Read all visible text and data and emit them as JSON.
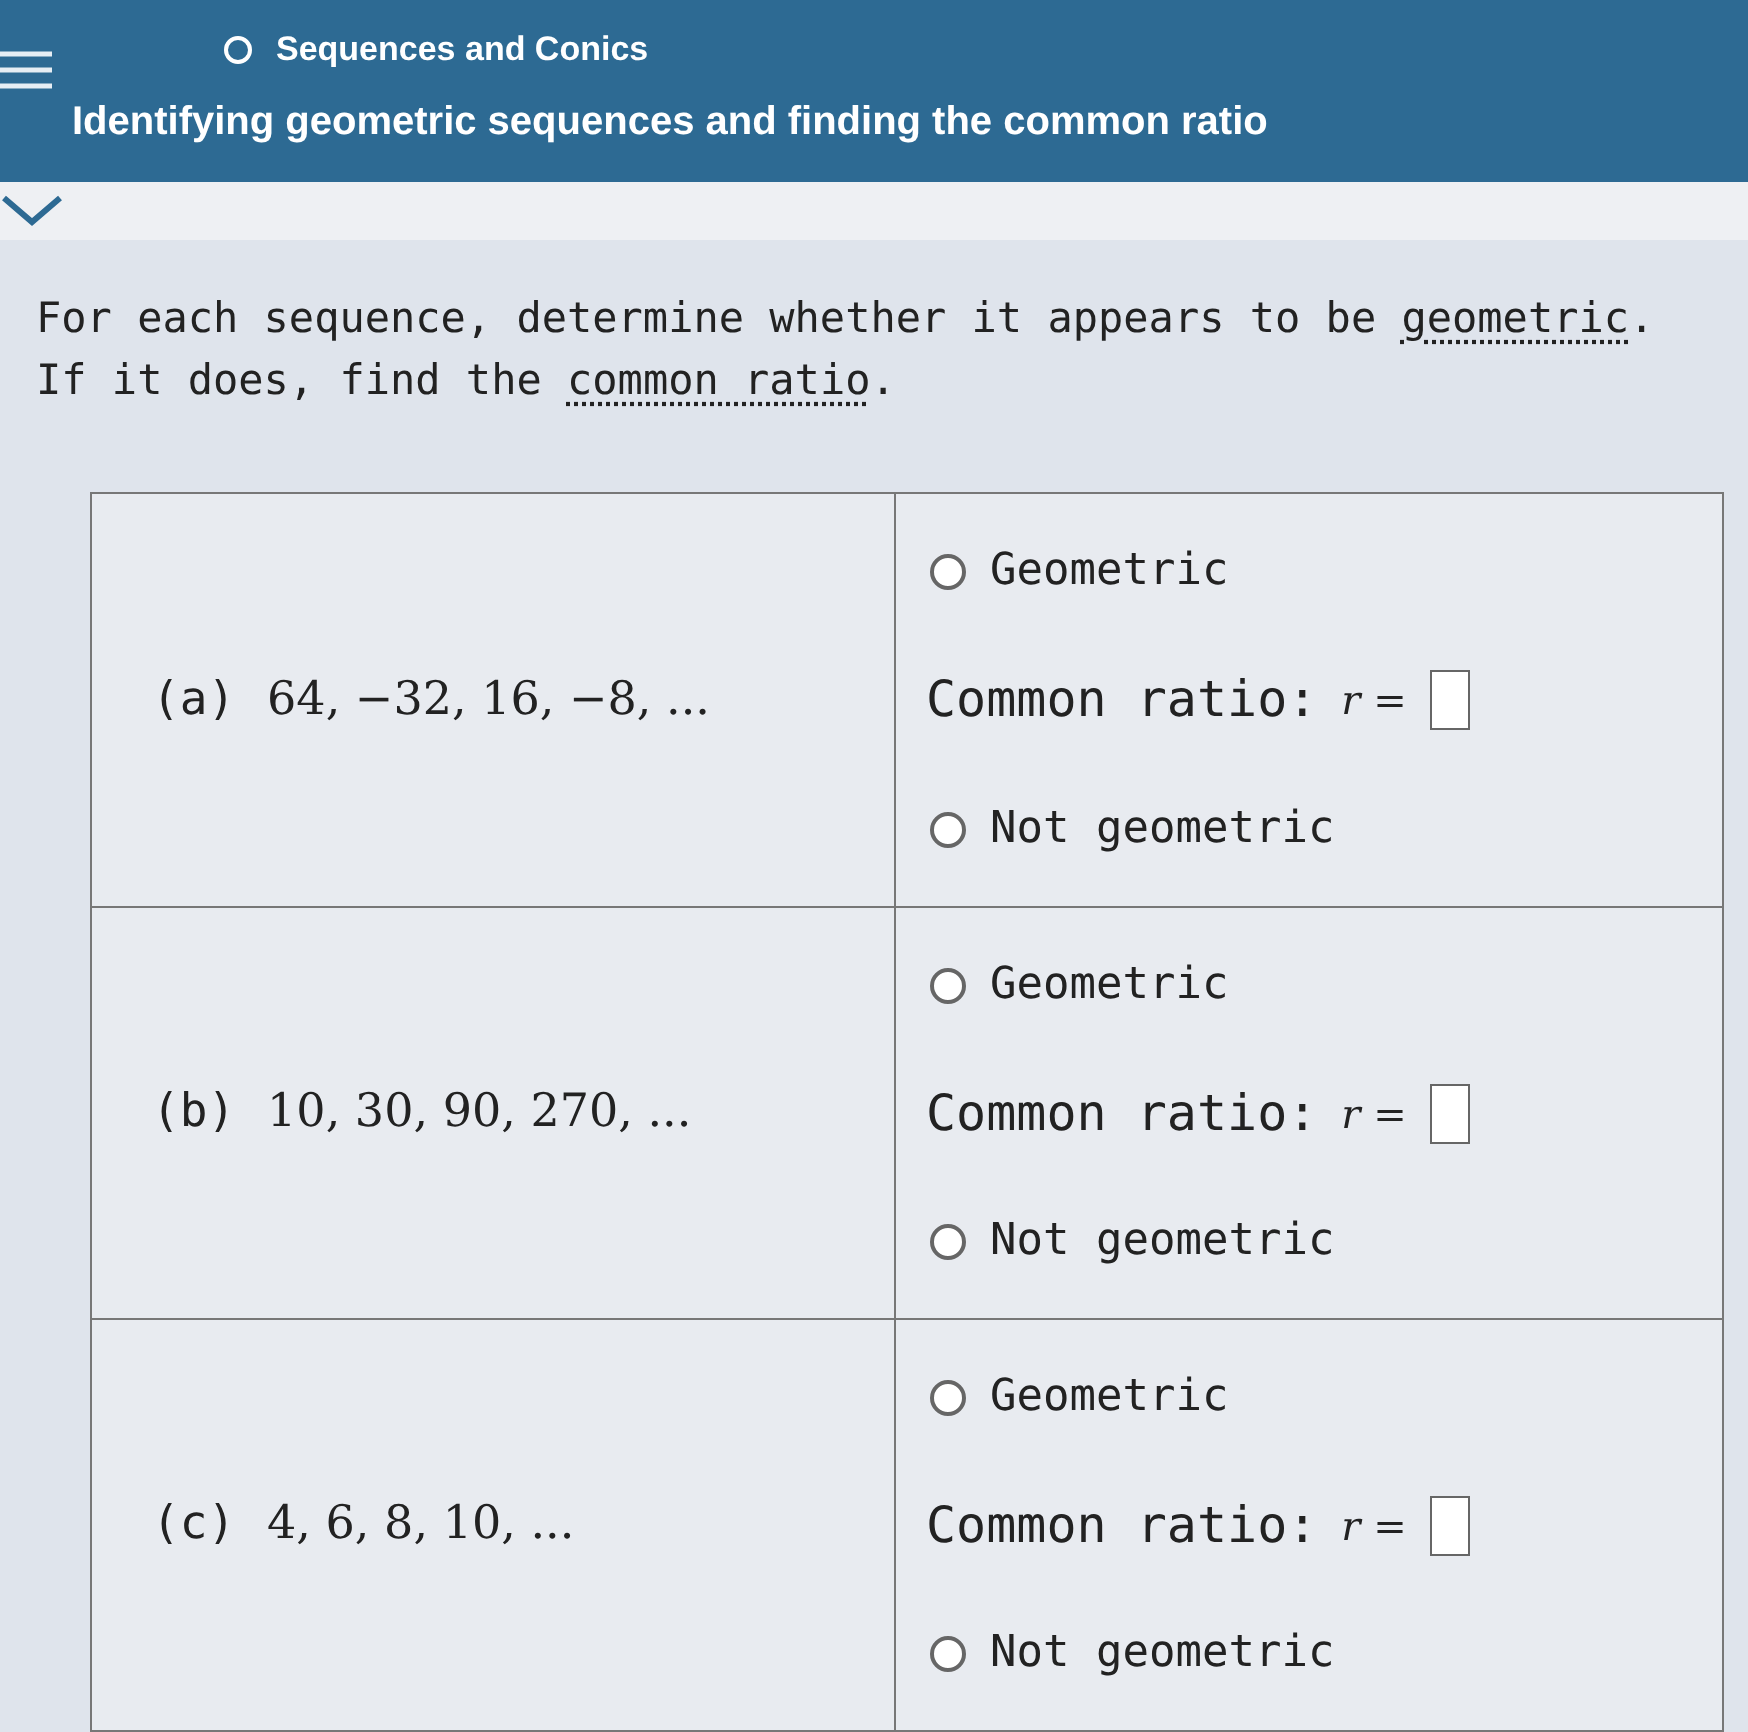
{
  "header": {
    "topic": "Sequences and Conics",
    "title": "Identifying geometric sequences and finding the common ratio"
  },
  "instructions": [
    [
      {
        "kind": "text",
        "text": "For each sequence, determine whether it appears to be "
      },
      {
        "kind": "link",
        "text": "geometric"
      },
      {
        "kind": "text",
        "text": "."
      }
    ],
    [
      {
        "kind": "text",
        "text": "If it does, find the "
      },
      {
        "kind": "link",
        "text": "common ratio"
      },
      {
        "kind": "text",
        "text": "."
      }
    ]
  ],
  "rows": [
    {
      "label": "(a)",
      "sequence": "64, −32, 16, −8, ...",
      "options": [
        {
          "label": "Geometric",
          "selected": false
        },
        {
          "label": "Not geometric",
          "selected": false
        }
      ],
      "ratio_label": "Common ratio:",
      "ratio_var": "r ="
    },
    {
      "label": "(b)",
      "sequence": "10, 30, 90, 270, ...",
      "options": [
        {
          "label": "Geometric",
          "selected": false
        },
        {
          "label": "Not geometric",
          "selected": false
        }
      ],
      "ratio_label": "Common ratio:",
      "ratio_var": "r ="
    },
    {
      "label": "(c)",
      "sequence": "4, 6, 8, 10, ...",
      "options": [
        {
          "label": "Geometric",
          "selected": false
        },
        {
          "label": "Not geometric",
          "selected": false
        }
      ],
      "ratio_label": "Common ratio:",
      "ratio_var": "r ="
    }
  ]
}
